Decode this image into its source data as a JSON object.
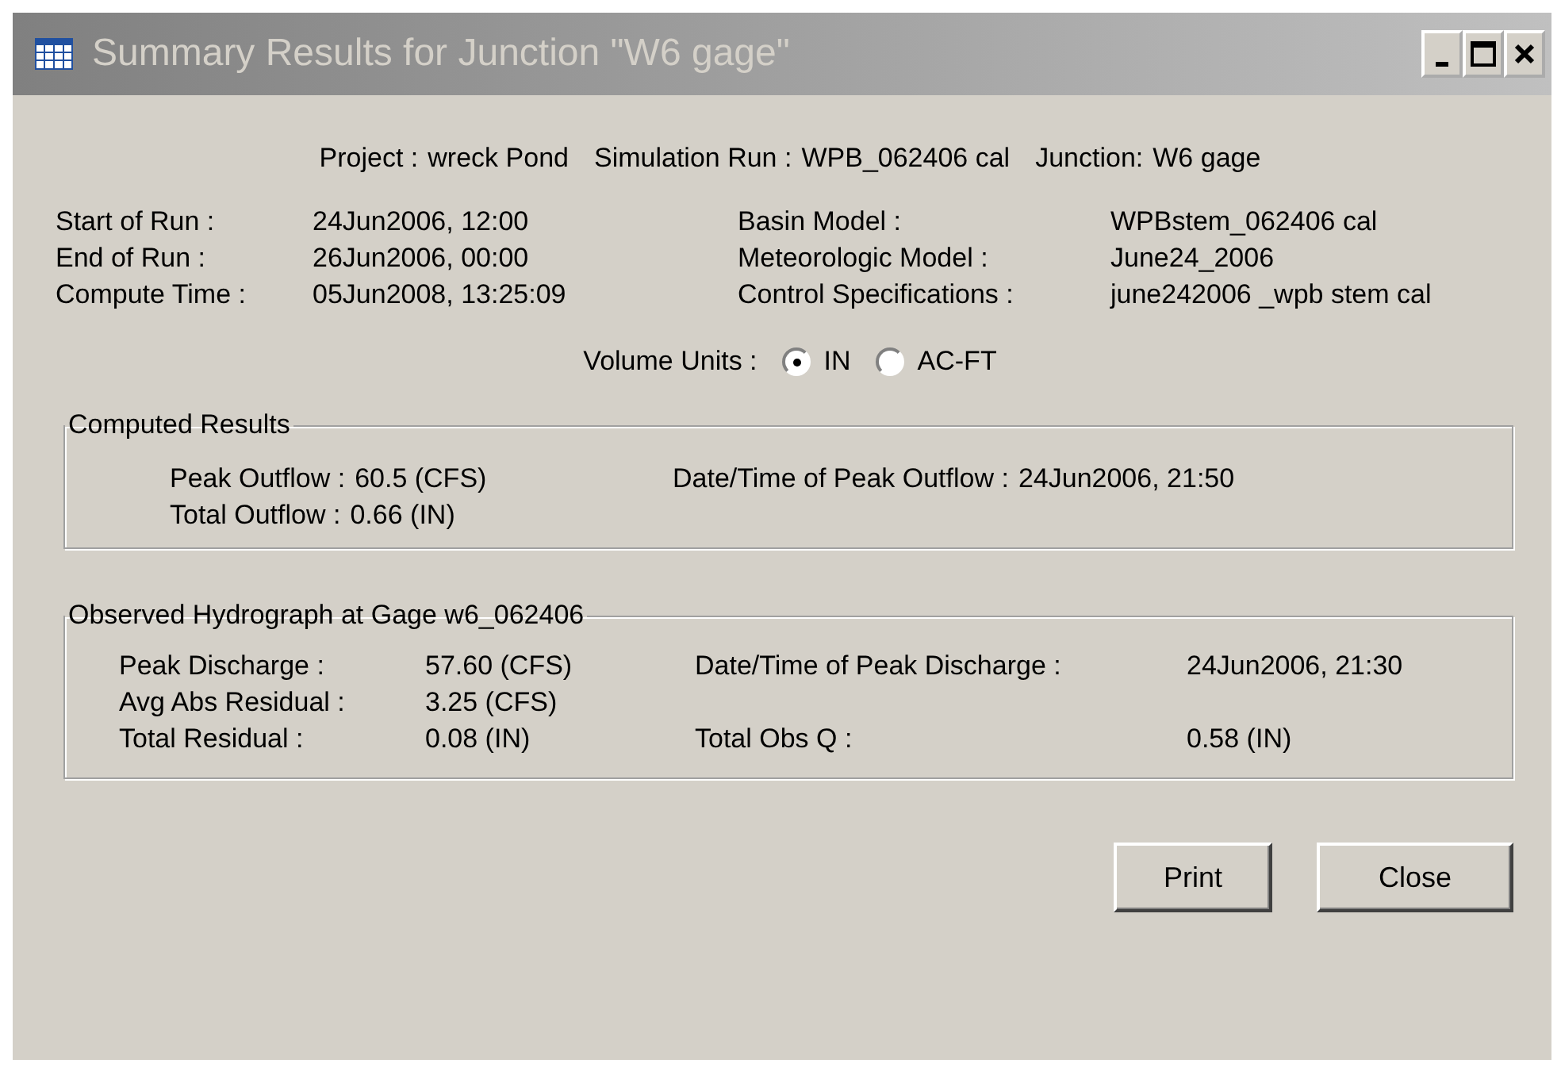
{
  "window": {
    "title": "Summary Results for Junction \"W6 gage\""
  },
  "header": [
    {
      "label": "Project :",
      "value": "wreck Pond"
    },
    {
      "label": "Simulation Run :",
      "value": "WPB_062406 cal"
    },
    {
      "label": "Junction:",
      "value": "W6 gage"
    }
  ],
  "run_info": [
    {
      "label": "Start of Run :",
      "value": "24Jun2006, 12:00",
      "label_2": "Basin Model :",
      "value_2": "WPBstem_062406 cal"
    },
    {
      "label": "End of Run :",
      "value": "26Jun2006, 00:00",
      "label_2": "Meteorologic Model :",
      "value_2": "June24_2006"
    },
    {
      "label": "Compute Time :",
      "value": "05Jun2008, 13:25:09",
      "label_2": "Control Specifications :",
      "value_2": "june242006 _wpb stem cal"
    }
  ],
  "volume_units": {
    "label": "Volume Units :",
    "options": [
      {
        "label": "IN",
        "selected": true
      },
      {
        "label": "AC-FT",
        "selected": false
      }
    ]
  },
  "groups": [
    {
      "title": "Computed Results",
      "kind": "inline",
      "rows": [
        [
          {
            "label": "Peak Outflow :",
            "value": "60.5 (CFS)"
          },
          {
            "label": "Date/Time of Peak Outflow :",
            "value": "24Jun2006, 21:50"
          }
        ],
        [
          {
            "label": "Total Outflow :",
            "value": "0.66 (IN)"
          }
        ]
      ]
    },
    {
      "title": "Observed Hydrograph at Gage w6_062406",
      "kind": "aligned",
      "rows": [
        [
          {
            "label": "Peak Discharge :",
            "value": "57.60 (CFS)"
          },
          {
            "label": "Date/Time of Peak Discharge :",
            "value": "24Jun2006, 21:30"
          }
        ],
        [
          {
            "label": "Avg Abs Residual :",
            "value": "3.25 (CFS)"
          }
        ],
        [
          {
            "label": "Total Residual :",
            "value": "0.08 (IN)"
          },
          {
            "label": "Total Obs Q :",
            "value": "0.58 (IN)"
          }
        ]
      ]
    }
  ],
  "buttons": [
    "Print",
    "Close"
  ]
}
